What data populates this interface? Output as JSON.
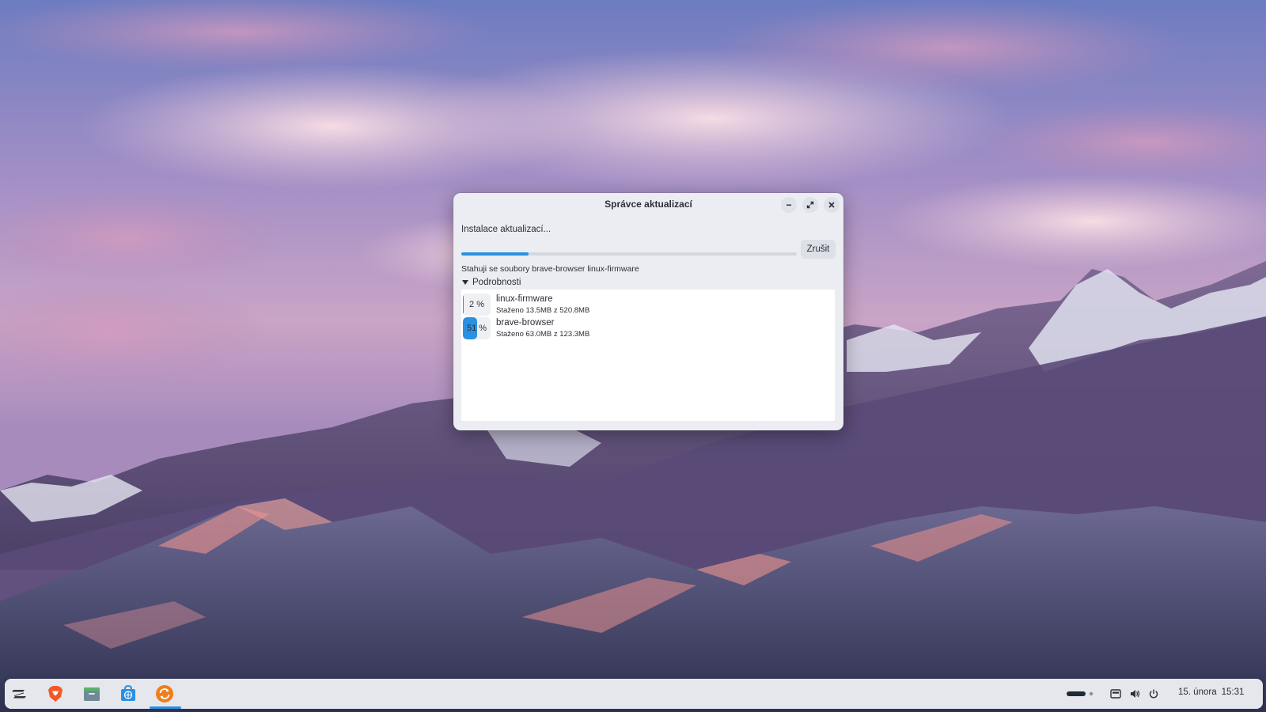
{
  "dialog": {
    "title": "Správce aktualizací",
    "status_text": "Instalace aktualizací...",
    "overall_progress": 0.2,
    "cancel_label": "Zrušit",
    "downloading_text": "Stahuji se soubory brave-browser linux-firmware",
    "details_label": "Podrobnosti",
    "packages": [
      {
        "name": "linux-firmware",
        "percent": 2,
        "percent_label": "2 %",
        "detail": "Staženo 13.5MB z 520.8MB"
      },
      {
        "name": "brave-browser",
        "percent": 51,
        "percent_label": "51 %",
        "detail": "Staženo 63.0MB z 123.3MB"
      }
    ]
  },
  "taskbar": {
    "apps": [
      "zorin-menu-icon",
      "brave-browser-icon",
      "files-icon",
      "software-store-icon",
      "update-manager-icon"
    ],
    "active_app": "update-manager-icon",
    "tray": [
      "workspace-indicator-icon",
      "keyboard-icon",
      "volume-icon",
      "power-icon"
    ],
    "date": "15. února",
    "time": "15:31"
  },
  "colors": {
    "accent": "#2a90e0",
    "dialog_bg": "#ebedf2",
    "taskbar_bg": "#eceef3"
  }
}
